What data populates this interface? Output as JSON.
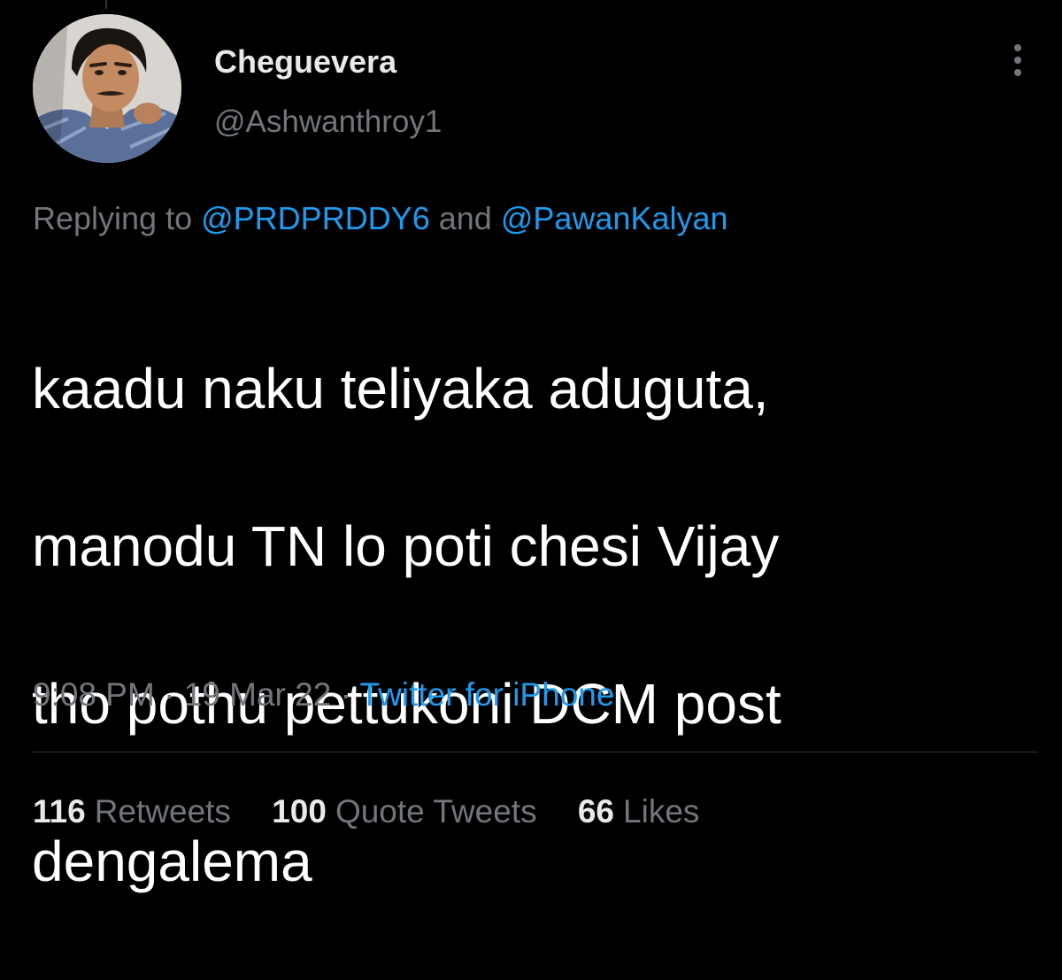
{
  "tweet": {
    "author": {
      "display_name": "Cheguevera",
      "handle": "@Ashwanthroy1"
    },
    "reply": {
      "prefix": "Replying to",
      "mention_1": "@PRDPRDDY6",
      "joiner": "and",
      "mention_2": "@PawanKalyan"
    },
    "text_lines": [
      "kaadu naku teliyaka aduguta,",
      "manodu TN lo poti chesi Vijay",
      "tho pothu pettukoni DCM post",
      "dengalema"
    ],
    "meta": {
      "time": "9:08 PM",
      "separator": "·",
      "date": "19 Mar 22",
      "source": "Twitter for iPhone"
    },
    "stats": {
      "retweets_count": "116",
      "retweets_label": "Retweets",
      "quotes_count": "100",
      "quotes_label": "Quote Tweets",
      "likes_count": "66",
      "likes_label": "Likes"
    }
  },
  "icons": {
    "avatar": "profile-photo",
    "more": "more-vertical-icon"
  },
  "colors": {
    "background": "#000000",
    "primary_text": "#e7e9ea",
    "tweet_text": "#ffffff",
    "secondary_text": "#71767b",
    "link": "#1d9bf0",
    "divider": "#2f3336"
  }
}
